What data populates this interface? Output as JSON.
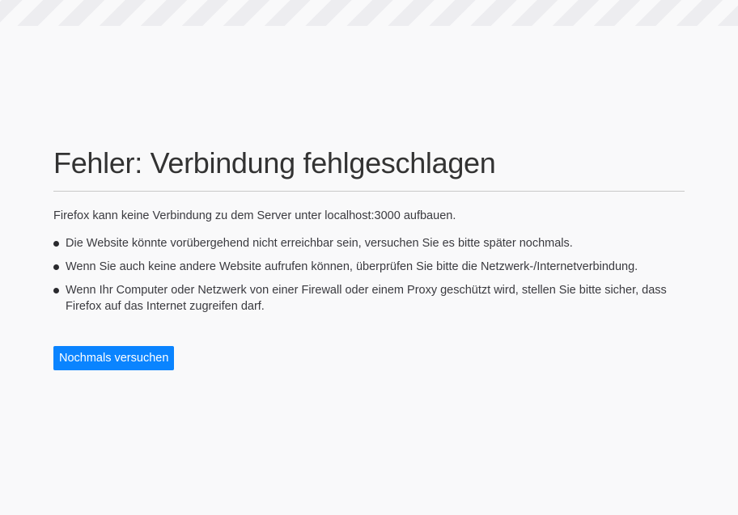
{
  "error": {
    "title": "Fehler: Verbindung fehlgeschlagen",
    "description": "Firefox kann keine Verbindung zu dem Server unter localhost:3000 aufbauen.",
    "suggestions": [
      "Die Website könnte vorübergehend nicht erreichbar sein, versuchen Sie es bitte später nochmals.",
      "Wenn Sie auch keine andere Website aufrufen können, überprüfen Sie bitte die Netzwerk-/Internetverbindung.",
      "Wenn Ihr Computer oder Netzwerk von einer Firewall oder einem Proxy geschützt wird, stellen Sie bitte sicher, dass Firefox auf das Internet zugreifen darf."
    ],
    "retry_label": "Nochmals versuchen"
  },
  "colors": {
    "background": "#f9f9fa",
    "stripe": "#ededf0",
    "button": "#0a84ff",
    "button_text": "#ffffff"
  }
}
